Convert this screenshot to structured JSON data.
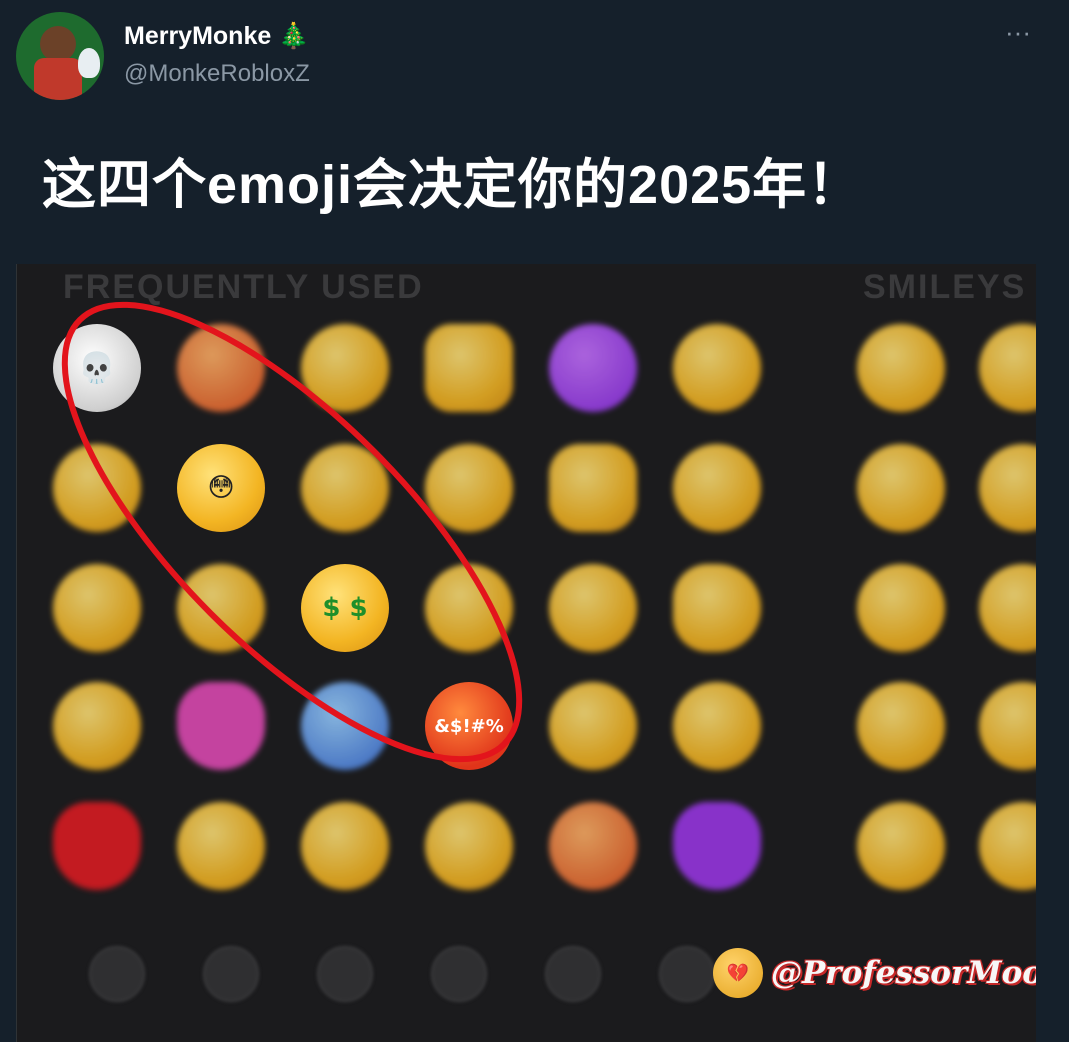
{
  "tweet": {
    "display_name": "MerryMonke 🎄",
    "handle": "@MonkeRobloxZ",
    "more_icon": "···",
    "text": "这四个emoji会决定你的2025年！"
  },
  "media": {
    "section_frequently_used": "FREQUENTLY USED",
    "section_smileys": "SMILEYS",
    "circled_emojis": [
      {
        "name": "skull",
        "glyph": "💀"
      },
      {
        "name": "flushed",
        "glyph": "😳"
      },
      {
        "name": "money-mouth",
        "glyph": "$ $"
      },
      {
        "name": "cursing",
        "glyph": "&$!#%"
      }
    ],
    "highlight_color": "#e3141c",
    "watermark": "@ProfessorMoody",
    "watermark_emoji": "💔"
  },
  "colors": {
    "background": "#15202b",
    "secondary_text": "#8b98a5"
  }
}
